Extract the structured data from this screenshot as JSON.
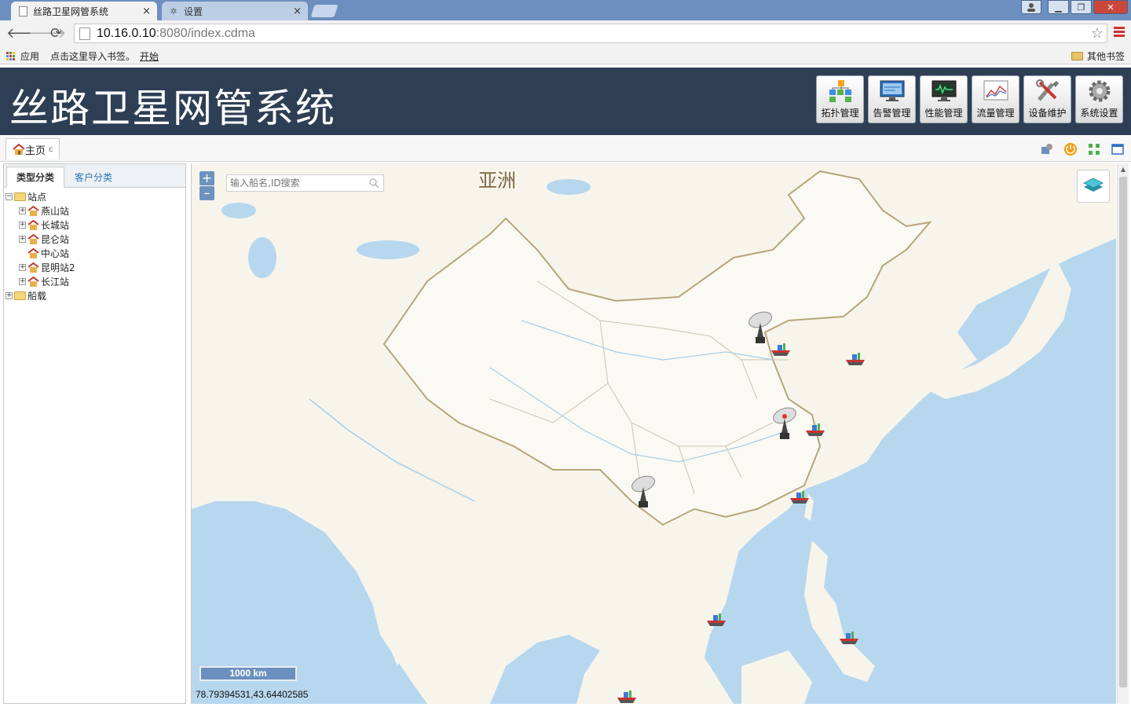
{
  "browser": {
    "tabs": [
      {
        "title": "丝路卫星网管系统",
        "active": true
      },
      {
        "title": "设置",
        "active": false
      }
    ],
    "url_host": "10.16.0.10",
    "url_rest": ":8080/index.cdma",
    "bookmarks": {
      "apps": "应用",
      "import_hint": "点击这里导入书签。",
      "start": "开始",
      "other": "其他书签"
    }
  },
  "app": {
    "title": "丝路卫星网管系统",
    "modules": [
      {
        "label": "拓扑管理",
        "icon": "topology-icon"
      },
      {
        "label": "告警管理",
        "icon": "alarm-monitor-icon"
      },
      {
        "label": "性能管理",
        "icon": "performance-monitor-icon"
      },
      {
        "label": "流量管理",
        "icon": "traffic-chart-icon"
      },
      {
        "label": "设备维护",
        "icon": "tools-icon"
      },
      {
        "label": "系统设置",
        "icon": "gear-icon"
      }
    ]
  },
  "tabbar": {
    "home_label": "主页",
    "home_refresh": "c"
  },
  "sidebar": {
    "tabs": [
      "类型分类",
      "客户分类"
    ],
    "tree": {
      "root_label": "站点",
      "stations": [
        "燕山站",
        "长城站",
        "昆仑站",
        "中心站",
        "昆明站2",
        "长江站"
      ],
      "shipborne_label": "船载"
    }
  },
  "map": {
    "region_label": "亚洲",
    "search_placeholder": "输入船名,ID搜索",
    "zoom_in": "+",
    "zoom_out": "–",
    "scale": "1000 km",
    "coordinates": "78.79394531,43.64402585"
  },
  "colors": {
    "header_bg": "#2e3f55",
    "sea": "#b7d7ee",
    "land": "#f7f4ec",
    "china": "#fbf9f3"
  }
}
